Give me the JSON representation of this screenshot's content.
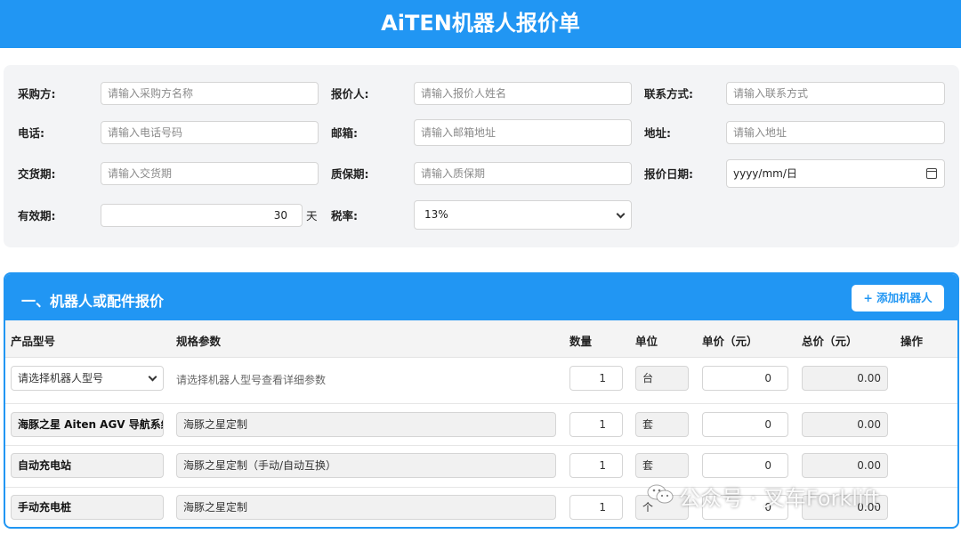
{
  "header": {
    "title": "AiTEN机器人报价单"
  },
  "info": {
    "buyer_label": "采购方:",
    "buyer_placeholder": "请输入采购方名称",
    "quoter_label": "报价人:",
    "quoter_placeholder": "请输入报价人姓名",
    "contact_label": "联系方式:",
    "contact_placeholder": "请输入联系方式",
    "phone_label": "电话:",
    "phone_placeholder": "请输入电话号码",
    "email_label": "邮箱:",
    "email_placeholder": "请输入邮箱地址",
    "address_label": "地址:",
    "address_placeholder": "请输入地址",
    "delivery_label": "交货期:",
    "delivery_placeholder": "请输入交货期",
    "warranty_label": "质保期:",
    "warranty_placeholder": "请输入质保期",
    "date_label": "报价日期:",
    "date_placeholder": "yyyy/mm/日",
    "validity_label": "有效期:",
    "validity_value": "30",
    "validity_unit": "天",
    "tax_label": "税率:",
    "tax_value": "13%"
  },
  "section": {
    "title": "一、机器人或配件报价",
    "add_button": "+ 添加机器人",
    "columns": [
      "产品型号",
      "规格参数",
      "数量",
      "单位",
      "单价（元）",
      "总价（元）",
      "操作"
    ],
    "rows": [
      {
        "model": "请选择机器人型号",
        "spec": "请选择机器人型号查看详细参数",
        "qty": "1",
        "unit": "台",
        "price": "0",
        "total": "0.00"
      },
      {
        "model": "海豚之星 Aiten AGV 导航系统",
        "spec": "海豚之星定制",
        "qty": "1",
        "unit": "套",
        "price": "0",
        "total": "0.00"
      },
      {
        "model": "自动充电站",
        "spec": "海豚之星定制（手动/自动互换）",
        "qty": "1",
        "unit": "套",
        "price": "0",
        "total": "0.00"
      },
      {
        "model": "手动充电桩",
        "spec": "海豚之星定制",
        "qty": "1",
        "unit": "个",
        "price": "0",
        "total": "0.00"
      }
    ]
  },
  "watermark": {
    "text": "公众号 · 叉车Forklift",
    "icon": "wechat-icon"
  },
  "colors": {
    "accent": "#2196f3",
    "panel": "#f3f4f6"
  }
}
